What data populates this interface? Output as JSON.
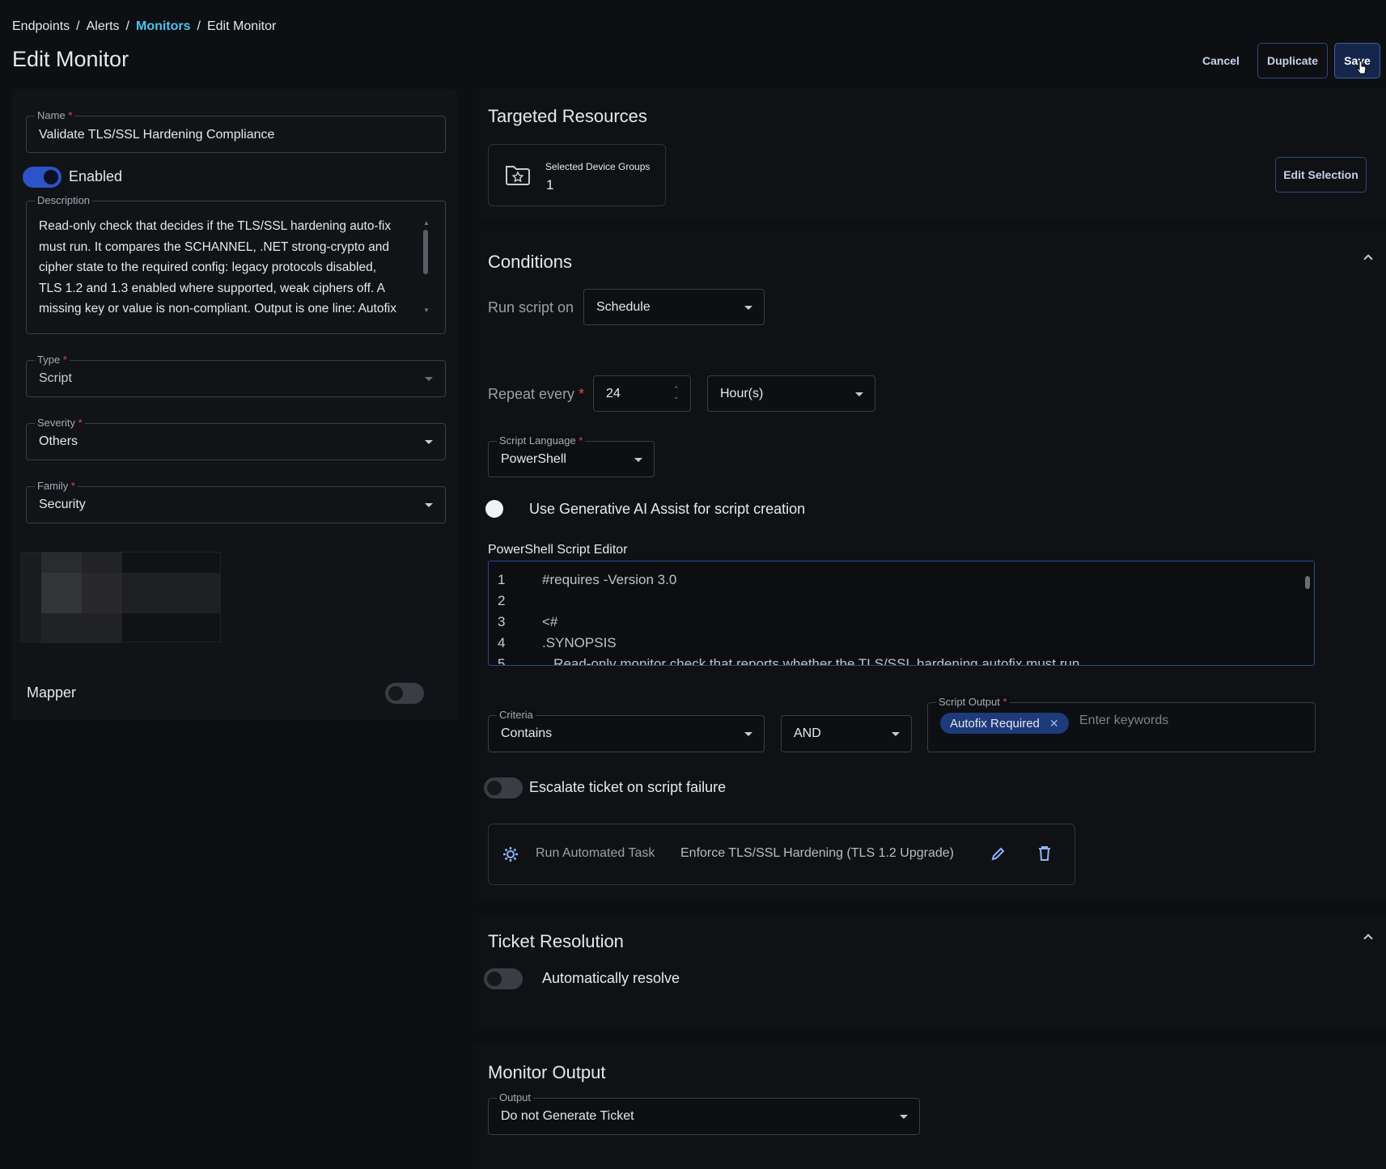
{
  "breadcrumb": {
    "items": [
      "Endpoints",
      "Alerts",
      "Monitors",
      "Edit Monitor"
    ],
    "separator": "/"
  },
  "page_title": "Edit Monitor",
  "actions": {
    "cancel": "Cancel",
    "duplicate": "Duplicate",
    "save": "Save"
  },
  "left": {
    "name": {
      "label": "Name",
      "value": "Validate TLS/SSL Hardening Compliance"
    },
    "enabled": {
      "label": "Enabled",
      "on": true
    },
    "description": {
      "label": "Description",
      "lines": [
        "Read-only check that decides if the TLS/SSL hardening auto-fix",
        "must run. It compares the SCHANNEL, .NET strong-crypto and",
        "cipher state to the required config: legacy protocols disabled,",
        "TLS 1.2 and 1.3 enabled where supported, weak ciphers off. A",
        "missing key or value is non-compliant. Output is one line: Autofix"
      ]
    },
    "type": {
      "label": "Type",
      "value": "Script"
    },
    "severity": {
      "label": "Severity",
      "value": "Others"
    },
    "family": {
      "label": "Family",
      "value": "Security"
    },
    "mapper": {
      "label": "Mapper",
      "on": false
    }
  },
  "targeted": {
    "title": "Targeted Resources",
    "groups_label": "Selected Device Groups",
    "groups_count": "1",
    "edit_button": "Edit Selection"
  },
  "conditions": {
    "title": "Conditions",
    "run_on_label": "Run script on",
    "run_on_value": "Schedule",
    "repeat_label": "Repeat every",
    "repeat_value": "24",
    "repeat_unit": "Hour(s)",
    "script_language": {
      "label": "Script Language",
      "value": "PowerShell"
    },
    "ai_assist_label": "Use Generative AI Assist for script creation",
    "editor_label": "PowerShell Script Editor",
    "editor_lines": [
      {
        "n": "1",
        "code": "#requires -Version 3.0"
      },
      {
        "n": "2",
        "code": ""
      },
      {
        "n": "3",
        "code": "<#"
      },
      {
        "n": "4",
        "code": ".SYNOPSIS"
      },
      {
        "n": "5",
        "code": "   Read-only monitor check that reports whether the TLS/SSL hardening autofix must run."
      }
    ],
    "criteria": {
      "label": "Criteria",
      "value": "Contains"
    },
    "logic": "AND",
    "script_output": {
      "label": "Script Output",
      "chips": [
        "Autofix Required"
      ],
      "placeholder": "Enter keywords"
    },
    "escalate": {
      "label": "Escalate ticket on script failure",
      "on": false
    },
    "task": {
      "label": "Run Automated Task",
      "name": "Enforce TLS/SSL Hardening (TLS 1.2 Upgrade)"
    }
  },
  "ticket_resolution": {
    "title": "Ticket Resolution",
    "auto_resolve": {
      "label": "Automatically resolve",
      "on": false
    }
  },
  "monitor_output": {
    "title": "Monitor Output",
    "output": {
      "label": "Output",
      "value": "Do not Generate Ticket"
    }
  },
  "colors": {
    "accent": "#4cc3f0",
    "toggle_on": "#2c54c7",
    "required": "#e5484d",
    "chip": "#1d3a7a"
  }
}
